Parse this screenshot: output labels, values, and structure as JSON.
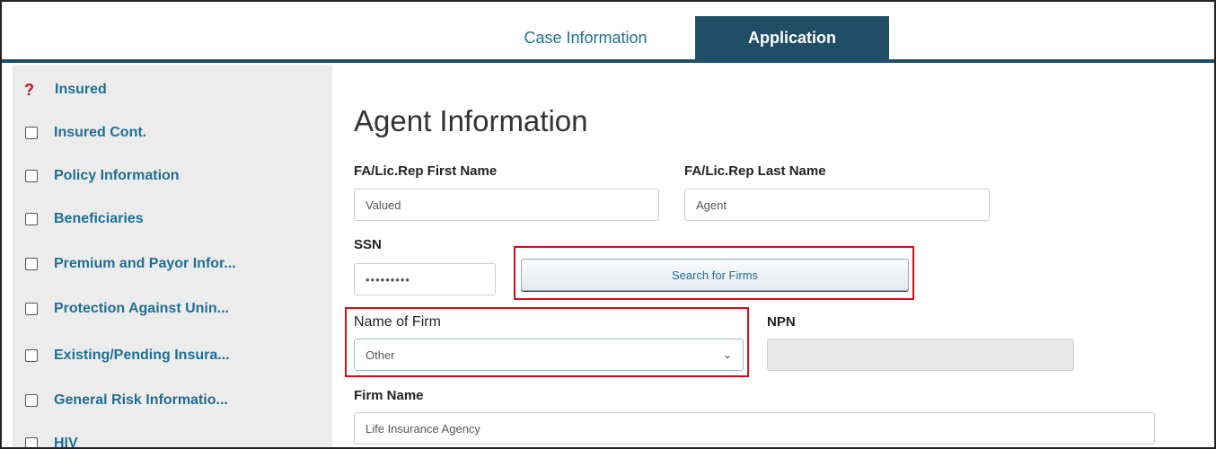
{
  "tabs": [
    {
      "label": "Case Information"
    },
    {
      "label": "Application"
    }
  ],
  "sidebar": {
    "items": [
      {
        "label": "Insured",
        "icon": "question-icon",
        "status": "incomplete"
      },
      {
        "label": "Insured Cont.",
        "icon": "checkbox-icon"
      },
      {
        "label": "Policy Information",
        "icon": "checkbox-icon"
      },
      {
        "label": "Beneficiaries",
        "icon": "checkbox-icon"
      },
      {
        "label": "Premium and Payor Infor...",
        "icon": "checkbox-icon"
      },
      {
        "label": "Protection Against Unin...",
        "icon": "checkbox-icon"
      },
      {
        "label": "Existing/Pending Insura...",
        "icon": "checkbox-icon"
      },
      {
        "label": "General Risk Informatio...",
        "icon": "checkbox-icon"
      },
      {
        "label": "HIV",
        "icon": "checkbox-icon"
      }
    ]
  },
  "main": {
    "title": "Agent Information",
    "first_name": {
      "label": "FA/Lic.Rep First Name",
      "value": "Valued"
    },
    "last_name": {
      "label": "FA/Lic.Rep Last Name",
      "value": "Agent"
    },
    "ssn": {
      "label": "SSN",
      "value": "•••••••••"
    },
    "search_button": "Search for Firms",
    "firm_select": {
      "label": "Name of Firm",
      "value": "Other"
    },
    "npn": {
      "label": "NPN",
      "value": ""
    },
    "firm_name": {
      "label": "Firm Name",
      "value": "Life Insurance Agency"
    }
  },
  "colors": {
    "accent": "#1f4e66",
    "link": "#1f6f95",
    "highlight": "#d0101a",
    "error": "#c0121a"
  }
}
